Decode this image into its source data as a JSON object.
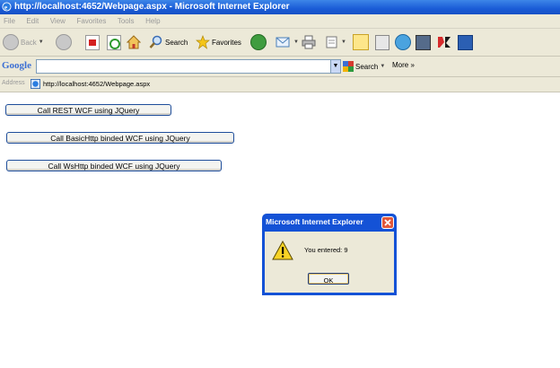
{
  "window": {
    "title": "http://localhost:4652/Webpage.aspx - Microsoft Internet Explorer"
  },
  "menu": [
    "File",
    "Edit",
    "View",
    "Favorites",
    "Tools",
    "Help"
  ],
  "toolbar": {
    "back_label": "Back",
    "search_label": "Search",
    "favorites_label": "Favorites"
  },
  "google": {
    "logo": "Google",
    "search_label": "Search",
    "more_label": "More »"
  },
  "address": {
    "label": "Address",
    "url": "http://localhost:4652/Webpage.aspx"
  },
  "page": {
    "buttons": [
      "Call REST WCF using JQuery",
      "Call BasicHttp binded WCF using JQuery",
      "Call WsHttp binded WCF using JQuery"
    ]
  },
  "dialog": {
    "title": "Microsoft Internet Explorer",
    "message": "You entered: 9",
    "ok_label": "OK"
  }
}
